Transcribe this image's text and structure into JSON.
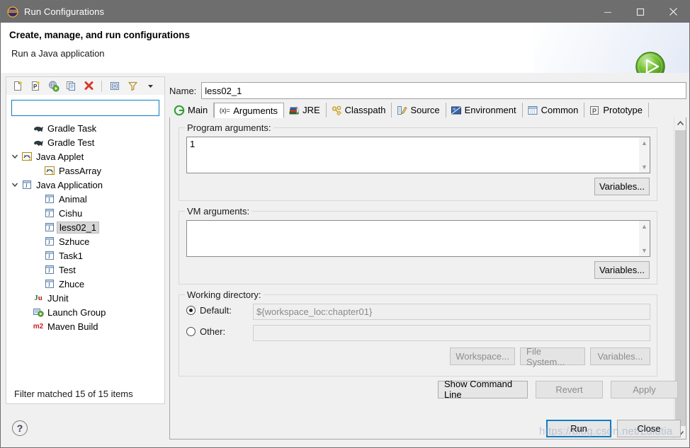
{
  "window": {
    "title": "Run Configurations",
    "icon": "eclipse-run-configurations-icon",
    "minimize_label": "—",
    "maximize_label": "□",
    "close_label": "✕"
  },
  "header": {
    "title": "Create, manage, and run configurations",
    "subtitle": "Run a Java application",
    "banner_icon": "green-run-play-icon"
  },
  "left_panel": {
    "toolbar": [
      {
        "name": "new-launch-configuration-icon",
        "tooltip": "New launch configuration"
      },
      {
        "name": "new-prototype-icon",
        "tooltip": "New prototype"
      },
      {
        "name": "export-launch-configuration-icon",
        "tooltip": "Export"
      },
      {
        "name": "duplicate-icon",
        "tooltip": "Duplicate"
      },
      {
        "name": "delete-icon",
        "tooltip": "Delete"
      },
      {
        "name": "collapse-all-icon",
        "tooltip": "Collapse All"
      },
      {
        "name": "filter-icon",
        "tooltip": "Filter launch configurations"
      },
      {
        "name": "view-menu-chevron-icon",
        "tooltip": "View Menu"
      }
    ],
    "filter": {
      "value": "",
      "placeholder": ""
    },
    "tree": [
      {
        "label": "Gradle Task",
        "icon": "gradle-elephant-icon",
        "depth": 1,
        "twisty": "none",
        "selected": false
      },
      {
        "label": "Gradle Test",
        "icon": "gradle-elephant-icon",
        "depth": 1,
        "twisty": "none",
        "selected": false
      },
      {
        "label": "Java Applet",
        "icon": "java-applet-icon",
        "depth": 0,
        "twisty": "expanded",
        "selected": false
      },
      {
        "label": "PassArray",
        "icon": "java-applet-icon",
        "depth": 2,
        "twisty": "none",
        "selected": false
      },
      {
        "label": "Java Application",
        "icon": "java-application-icon",
        "depth": 0,
        "twisty": "expanded",
        "selected": false
      },
      {
        "label": "Animal",
        "icon": "java-application-icon",
        "depth": 2,
        "twisty": "none",
        "selected": false
      },
      {
        "label": "Cishu",
        "icon": "java-application-icon",
        "depth": 2,
        "twisty": "none",
        "selected": false
      },
      {
        "label": "less02_1",
        "icon": "java-application-icon",
        "depth": 2,
        "twisty": "none",
        "selected": true
      },
      {
        "label": "Szhuce",
        "icon": "java-application-icon",
        "depth": 2,
        "twisty": "none",
        "selected": false
      },
      {
        "label": "Task1",
        "icon": "java-application-icon",
        "depth": 2,
        "twisty": "none",
        "selected": false
      },
      {
        "label": "Test",
        "icon": "java-application-icon",
        "depth": 2,
        "twisty": "none",
        "selected": false
      },
      {
        "label": "Zhuce",
        "icon": "java-application-icon",
        "depth": 2,
        "twisty": "none",
        "selected": false
      },
      {
        "label": "JUnit",
        "icon": "junit-icon",
        "depth": 1,
        "twisty": "none",
        "selected": false
      },
      {
        "label": "Launch Group",
        "icon": "launch-group-icon",
        "depth": 1,
        "twisty": "none",
        "selected": false
      },
      {
        "label": "Maven Build",
        "icon": "maven-m2-icon",
        "depth": 1,
        "twisty": "none",
        "selected": false
      }
    ],
    "status_text": "Filter matched 15 of 15 items"
  },
  "right_panel": {
    "name_label": "Name:",
    "name_value": "less02_1",
    "tabs": [
      {
        "label": "Main",
        "icon": "main-green-circle-icon",
        "active": false
      },
      {
        "label": "Arguments",
        "icon": "arguments-xequals-icon",
        "active": true
      },
      {
        "label": "JRE",
        "icon": "jre-books-icon",
        "active": false
      },
      {
        "label": "Classpath",
        "icon": "classpath-icon",
        "active": false
      },
      {
        "label": "Source",
        "icon": "source-pencil-icon",
        "active": false
      },
      {
        "label": "Environment",
        "icon": "environment-icon",
        "active": false
      },
      {
        "label": "Common",
        "icon": "common-window-icon",
        "active": false
      },
      {
        "label": "Prototype",
        "icon": "prototype-p-icon",
        "active": false
      }
    ],
    "program_arguments": {
      "legend": "Program arguments:",
      "value": "1",
      "variables_button": "Variables..."
    },
    "vm_arguments": {
      "legend": "VM arguments:",
      "value": "",
      "variables_button": "Variables..."
    },
    "working_directory": {
      "legend": "Working directory:",
      "default_radio_label": "Default:",
      "default_radio_selected": true,
      "default_value": "${workspace_loc:chapter01}",
      "other_radio_label": "Other:",
      "other_radio_selected": false,
      "other_value": "",
      "workspace_button": "Workspace...",
      "file_system_button": "File System...",
      "variables_button": "Variables..."
    }
  },
  "action_bar": {
    "show_command_line": "Show Command Line",
    "revert": "Revert",
    "revert_disabled": true,
    "apply": "Apply",
    "apply_disabled": true
  },
  "footer": {
    "help_icon": "question-mark-help-icon",
    "run_button": "Run",
    "close_button": "Close",
    "watermark": "https://blog.csdn.net/Lulutia"
  },
  "colors": {
    "titlebar_bg": "#6e6e6e",
    "dialog_bg": "#f0f0f0",
    "accent_blue": "#0f7cc4",
    "selection_gray": "#d5d5d5",
    "run_green": "#4caf23",
    "delete_red": "#d93a2b",
    "maven_red": "#d12121"
  }
}
